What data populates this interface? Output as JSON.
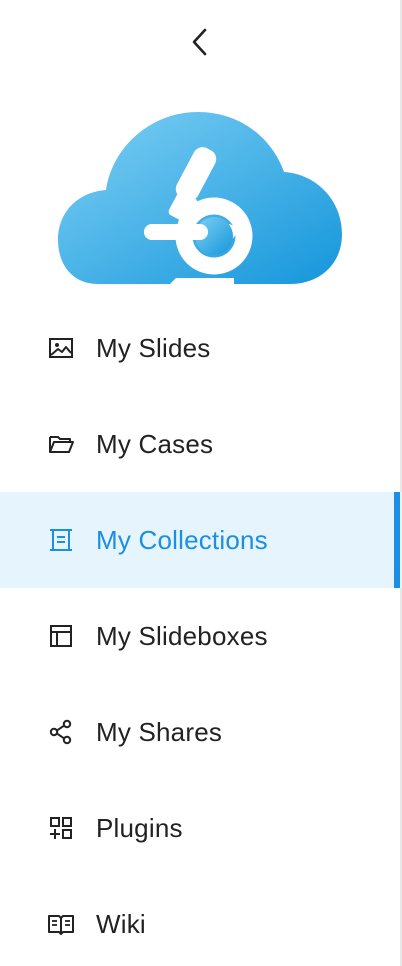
{
  "sidebar": {
    "collapse": {
      "icon": "chevron-left-icon"
    },
    "logo": {
      "icon": "cloud-microscope-logo"
    },
    "items": [
      {
        "label": "My Slides",
        "icon": "image-icon",
        "active": false
      },
      {
        "label": "My Cases",
        "icon": "folder-open-icon",
        "active": false
      },
      {
        "label": "My Collections",
        "icon": "collection-icon",
        "active": true
      },
      {
        "label": "My Slideboxes",
        "icon": "slidebox-icon",
        "active": false
      },
      {
        "label": "My Shares",
        "icon": "share-icon",
        "active": false
      },
      {
        "label": "Plugins",
        "icon": "plugins-icon",
        "active": false
      },
      {
        "label": "Wiki",
        "icon": "book-icon",
        "active": false
      }
    ],
    "colors": {
      "accent": "#1a8fe3",
      "active_bg": "#e6f4fd",
      "text": "#222222",
      "logo_light": "#6cc3ef",
      "logo_dark": "#1b9de0"
    }
  }
}
